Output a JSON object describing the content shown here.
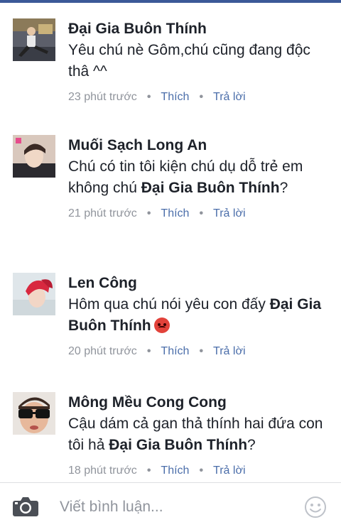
{
  "comments": [
    {
      "author": "Đại Gia Buôn Thính",
      "text_plain": "Yêu chú nè Gôm,chú cũng đang độc thâ ^^",
      "time": "23 phút trước",
      "like": "Thích",
      "reply": "Trả lời",
      "avatar_icon": "profile-photo-dancer"
    },
    {
      "author": "Muối Sạch Long An",
      "text_plain": "Chú có tin tôi kiện chú dụ dỗ trẻ em không chú ",
      "mention": "Đại Gia Buôn Thính",
      "text_after": "?",
      "time": "21 phút trước",
      "like": "Thích",
      "reply": "Trả lời",
      "avatar_icon": "profile-photo-man"
    },
    {
      "author": "Len Công",
      "text_plain": "Hôm qua chú nói yêu con đấy ",
      "mention": "Đại Gia Buôn Thính",
      "emoji": "angry-face-emoji",
      "time": "20 phút trước",
      "like": "Thích",
      "reply": "Trả lời",
      "avatar_icon": "profile-photo-red-hair"
    },
    {
      "author": "Mông Mều Cong Cong",
      "text_plain": "Cậu dám cả gan thả thính hai đứa con tôi hả ",
      "mention": "Đại Gia Buôn Thính",
      "text_after": "?",
      "time": "18 phút trước",
      "like": "Thích",
      "reply": "Trả lời",
      "avatar_icon": "profile-photo-sunglasses"
    }
  ],
  "composer": {
    "placeholder": "Viết bình luận...",
    "camera_icon": "camera-icon",
    "emoji_icon": "smiley-icon"
  },
  "colors": {
    "accent": "#3b5998",
    "action_link": "#4b6eaa",
    "meta_gray": "#90949c",
    "text": "#1d2129"
  }
}
